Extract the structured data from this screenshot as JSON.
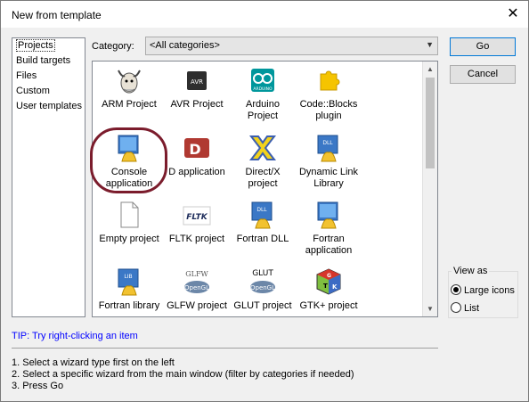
{
  "window": {
    "title": "New from template",
    "close_glyph": "✕"
  },
  "categories": {
    "items": [
      "Projects",
      "Build targets",
      "Files",
      "Custom",
      "User templates"
    ],
    "selected": "Projects"
  },
  "category_filter": {
    "label": "Category:",
    "value": "<All categories>"
  },
  "templates": [
    {
      "line1": "ARM Project",
      "line2": "",
      "icon": "gnu-icon"
    },
    {
      "line1": "AVR Project",
      "line2": "",
      "icon": "avr-chip-icon"
    },
    {
      "line1": "Arduino",
      "line2": "Project",
      "icon": "arduino-icon",
      "icon_text": "ARDUINO"
    },
    {
      "line1": "Code::Blocks",
      "line2": "plugin",
      "icon": "puzzle-plugin-icon"
    },
    {
      "line1": "Console",
      "line2": "application",
      "icon": "console-shell-icon"
    },
    {
      "line1": "D application",
      "line2": "",
      "icon": "d-language-icon"
    },
    {
      "line1": "Direct/X",
      "line2": "project",
      "icon": "directx-icon"
    },
    {
      "line1": "Dynamic Link",
      "line2": "Library",
      "icon": "dll-icon",
      "icon_text": "DLL"
    },
    {
      "line1": "Empty project",
      "line2": "",
      "icon": "blank-page-icon"
    },
    {
      "line1": "FLTK project",
      "line2": "",
      "icon": "fltk-icon",
      "icon_text": "FLTK"
    },
    {
      "line1": "Fortran DLL",
      "line2": "",
      "icon": "fortran-dll-icon",
      "icon_text": "DLL"
    },
    {
      "line1": "Fortran",
      "line2": "application",
      "icon": "fortran-app-icon"
    },
    {
      "line1": "Fortran library",
      "line2": "",
      "icon": "fortran-lib-icon",
      "icon_text": "LIB"
    },
    {
      "line1": "GLFW project",
      "line2": "",
      "icon": "glfw-icon",
      "icon_text": "GLFW"
    },
    {
      "line1": "GLUT project",
      "line2": "",
      "icon": "glut-icon",
      "icon_text": "GLUT"
    },
    {
      "line1": "GTK+ project",
      "line2": "",
      "icon": "gtk-icon"
    }
  ],
  "buttons": {
    "go": "Go",
    "cancel": "Cancel"
  },
  "view_as": {
    "legend": "View as",
    "large_icons": "Large icons",
    "list": "List",
    "selected": "Large icons"
  },
  "tip": "TIP: Try right-clicking an item",
  "help": {
    "step1": "1. Select a wizard type first on the left",
    "step2": "2. Select a specific wizard from the main window (filter by categories if needed)",
    "step3": "3. Press Go"
  },
  "colors": {
    "highlight_ring": "#7b1c2c",
    "tip_text": "#0000ff",
    "go_border": "#0078d7"
  }
}
